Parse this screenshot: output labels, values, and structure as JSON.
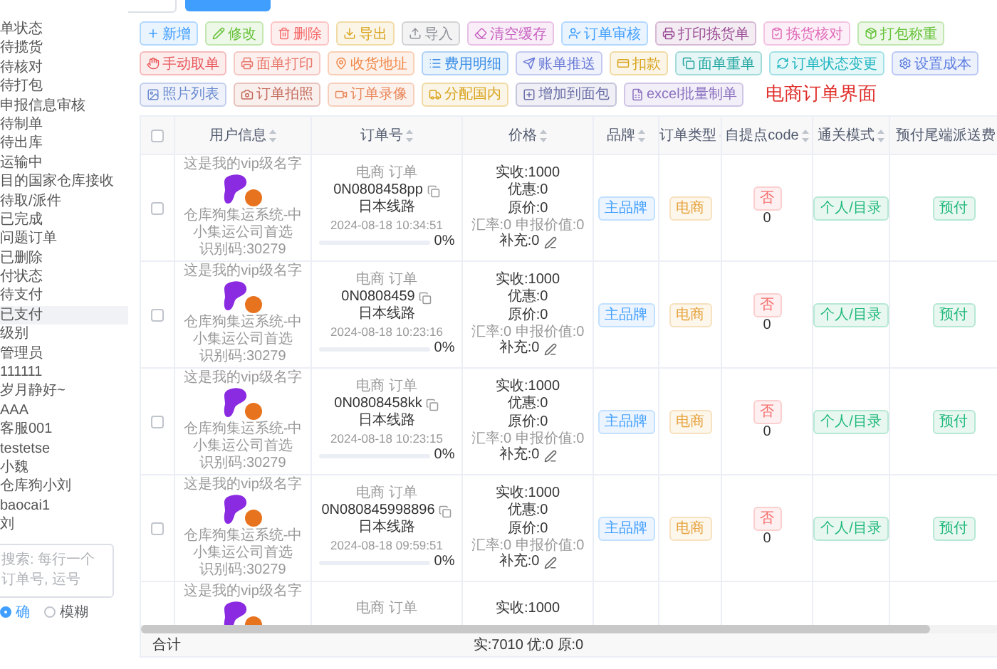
{
  "sidebar": {
    "items": [
      {
        "label": "单状态",
        "selected": false
      },
      {
        "label": "待揽货",
        "selected": false
      },
      {
        "label": "待核对",
        "selected": false
      },
      {
        "label": "待打包",
        "selected": false
      },
      {
        "label": "申报信息审核",
        "selected": false
      },
      {
        "label": "待制单",
        "selected": false
      },
      {
        "label": "待出库",
        "selected": false
      },
      {
        "label": "运输中",
        "selected": false
      },
      {
        "label": "目的国家仓库接收",
        "selected": false
      },
      {
        "label": "待取/派件",
        "selected": false
      },
      {
        "label": "已完成",
        "selected": false
      },
      {
        "label": "问题订单",
        "selected": false
      },
      {
        "label": "已删除",
        "selected": false
      },
      {
        "label": "付状态",
        "selected": false
      },
      {
        "label": "待支付",
        "selected": false
      },
      {
        "label": "已支付",
        "selected": true
      },
      {
        "label": "级别",
        "selected": false
      },
      {
        "label": "管理员",
        "selected": false
      },
      {
        "label": "111111",
        "selected": false
      },
      {
        "label": "岁月静好~",
        "selected": false
      },
      {
        "label": "AAA",
        "selected": false
      },
      {
        "label": "客服001",
        "selected": false
      },
      {
        "label": "testetse",
        "selected": false
      },
      {
        "label": "小魏",
        "selected": false
      },
      {
        "label": "仓库狗小刘",
        "selected": false
      },
      {
        "label": "baocai1",
        "selected": false
      },
      {
        "label": "刘",
        "selected": false
      }
    ],
    "search": {
      "placeholder": "搜索: 每行一个订单号, 运号"
    },
    "match_modes": [
      {
        "label": "确",
        "selected": true
      },
      {
        "label": "模糊",
        "selected": false
      }
    ]
  },
  "toolbar": {
    "buttons": [
      {
        "label": "新增",
        "color": "#409eff"
      },
      {
        "label": "修改",
        "color": "#67c23a"
      },
      {
        "label": "删除",
        "color": "#f56c6c"
      },
      {
        "label": "导出",
        "color": "#d9a520"
      },
      {
        "label": "导入",
        "color": "#909399"
      },
      {
        "label": "清空缓存",
        "color": "#c760c0"
      },
      {
        "label": "订单审核",
        "color": "#409eff"
      },
      {
        "label": "打印拣货单",
        "color": "#9b4f96"
      },
      {
        "label": "拣货核对",
        "color": "#e06bb8"
      },
      {
        "label": "打包称重",
        "color": "#67c23a"
      },
      {
        "label": "手动取单",
        "color": "#e8575a"
      },
      {
        "label": "面单打印",
        "color": "#e8776a"
      },
      {
        "label": "收货地址",
        "color": "#f0884a"
      },
      {
        "label": "费用明细",
        "color": "#3a8ee6"
      },
      {
        "label": "账单推送",
        "color": "#6b7bd8"
      },
      {
        "label": "扣款",
        "color": "#d9a520"
      },
      {
        "label": "面单重单",
        "color": "#1fa5a0"
      },
      {
        "label": "订单状态变更",
        "color": "#1fb5c0"
      },
      {
        "label": "设置成本",
        "color": "#5a7ce0"
      },
      {
        "label": "照片列表",
        "color": "#6a8bd0"
      },
      {
        "label": "订单拍照",
        "color": "#c46a5a"
      },
      {
        "label": "订单录像",
        "color": "#e8875a"
      },
      {
        "label": "分配国内",
        "color": "#d9a520"
      },
      {
        "label": "增加到面包",
        "color": "#6b6fa8"
      },
      {
        "label": "excel批量制单",
        "color": "#8a70c0"
      }
    ],
    "title": "电商订单界面"
  },
  "table": {
    "select_all": {
      "checked": false
    },
    "columns": [
      "用户信息",
      "订单号",
      "价格",
      "品牌",
      "订单类型",
      "自提点code",
      "通关模式",
      "预付尾端派送费"
    ],
    "rows": [
      {
        "checked": false,
        "user_name": "这是我的vip级名字",
        "company": "仓库狗集运系统-中小集运公司首选",
        "code_id": "识别码:30279",
        "order_label": "电商 订单",
        "order_no": "0N0808458pp",
        "route": "日本线路",
        "date": "2024-08-18 10:34:51",
        "level": 0,
        "progress_text": "0%",
        "received": "实收:1000",
        "discount": "优惠:0",
        "original": "原价:0",
        "rate": "汇率:0 申报价值:0",
        "extra": "补充:0",
        "brand": "主品牌",
        "order_type": "电商",
        "pickup": "否",
        "pickup_code": "0",
        "customs": "个人/目录",
        "prepay": "预付"
      },
      {
        "checked": false,
        "user_name": "这是我的vip级名字",
        "company": "仓库狗集运系统-中小集运公司首选",
        "code_id": "识别码:30279",
        "order_label": "电商 订单",
        "order_no": "0N0808459",
        "route": "日本线路",
        "date": "2024-08-18 10:23:16",
        "level": 0,
        "progress_text": "0%",
        "received": "实收:1000",
        "discount": "优惠:0",
        "original": "原价:0",
        "rate": "汇率:0 申报价值:0",
        "extra": "补充:0",
        "brand": "主品牌",
        "order_type": "电商",
        "pickup": "否",
        "pickup_code": "0",
        "customs": "个人/目录",
        "prepay": "预付"
      },
      {
        "checked": false,
        "user_name": "这是我的vip级名字",
        "company": "仓库狗集运系统-中小集运公司首选",
        "code_id": "识别码:30279",
        "order_label": "电商 订单",
        "order_no": "0N0808458kk",
        "route": "日本线路",
        "date": "2024-08-18 10:23:15",
        "level": 0,
        "progress_text": "0%",
        "received": "实收:1000",
        "discount": "优惠:0",
        "original": "原价:0",
        "rate": "汇率:0 申报价值:0",
        "extra": "补充:0",
        "brand": "主品牌",
        "order_type": "电商",
        "pickup": "否",
        "pickup_code": "0",
        "customs": "个人/目录",
        "prepay": "预付"
      },
      {
        "checked": false,
        "user_name": "这是我的vip级名字",
        "company": "仓库狗集运系统-中小集运公司首选",
        "code_id": "识别码:30279",
        "order_label": "电商 订单",
        "order_no": "0N080845998896",
        "route": "日本线路",
        "date": "2024-08-18 09:59:51",
        "level": 0,
        "progress_text": "0%",
        "received": "实收:1000",
        "discount": "优惠:0",
        "original": "原价:0",
        "rate": "汇率:0 申报价值:0",
        "extra": "补充:0",
        "brand": "主品牌",
        "order_type": "电商",
        "pickup": "否",
        "pickup_code": "0",
        "customs": "个人/目录",
        "prepay": "预付"
      },
      {
        "user_name": "这是我的vip级名字",
        "order_label": "电商 订单",
        "received": "实收:1000"
      }
    ],
    "footer": {
      "label": "合计",
      "total": "实:7010 优:0 原:0"
    }
  }
}
